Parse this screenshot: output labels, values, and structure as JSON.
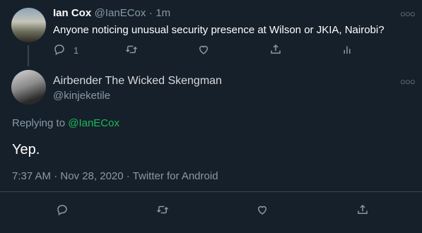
{
  "parent_tweet": {
    "author_name": "Ian Cox",
    "author_handle": "@IanECox",
    "separator": "·",
    "time_ago": "1m",
    "text": "Anyone noticing unusual security presence at Wilson or JKIA, Nairobi?",
    "reply_count": "1",
    "icons": [
      "more-icon",
      "reply-icon",
      "retweet-icon",
      "like-icon",
      "share-icon",
      "analytics-icon"
    ]
  },
  "main_tweet": {
    "author_name": "Airbender The Wicked Skengman",
    "author_handle": "@kinjeketile",
    "replying_to_prefix": "Replying to",
    "replying_to_handle": "@IanECox",
    "text": "Yep.",
    "timestamp": "7:37 AM · Nov 28, 2020 · Twitter for Android",
    "icons": [
      "more-icon",
      "reply-icon",
      "retweet-icon",
      "like-icon",
      "share-icon"
    ]
  },
  "colors": {
    "background": "#15202b",
    "mention": "#1db954",
    "muted": "#8899a6"
  }
}
